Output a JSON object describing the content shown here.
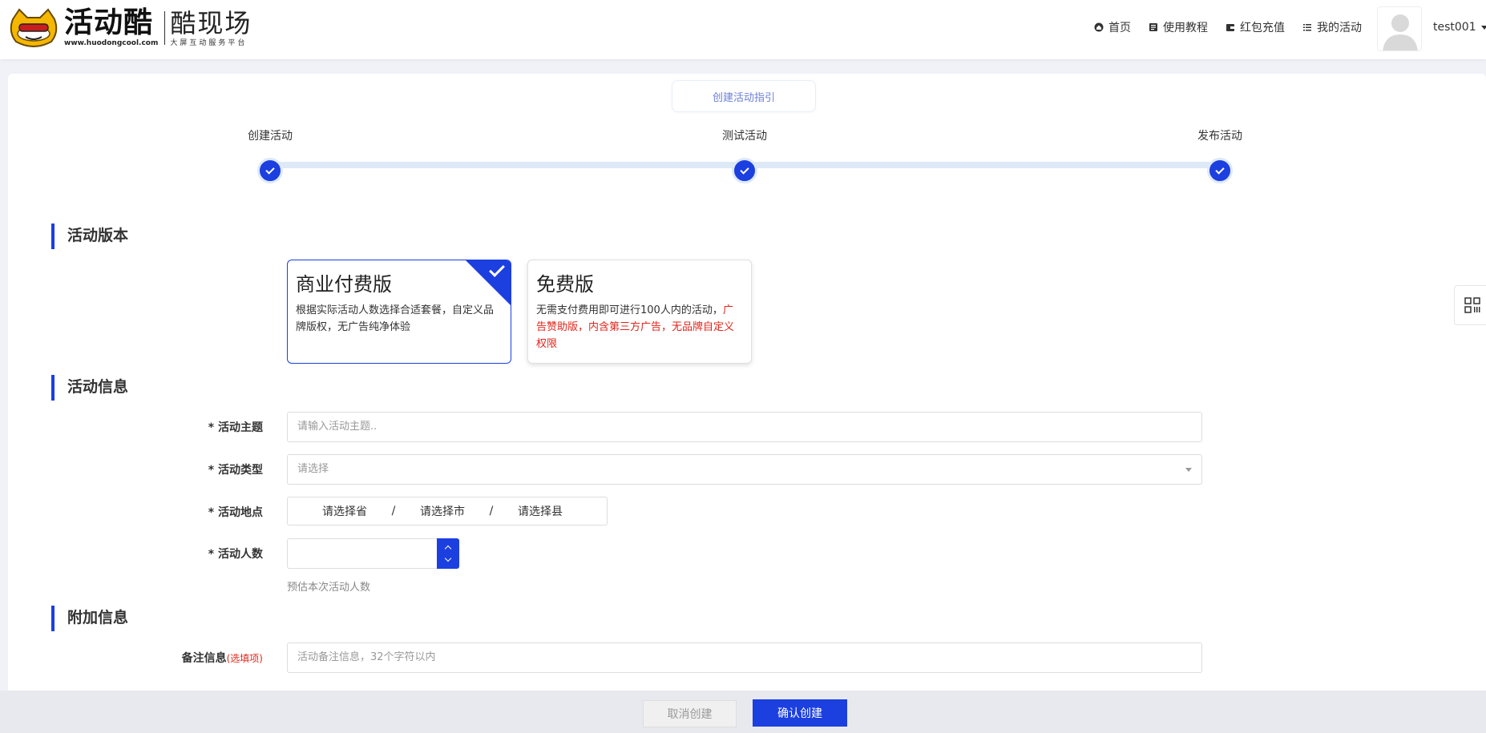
{
  "header": {
    "logo_main": "活动酷",
    "logo_url": "www.huodongcool.com",
    "logo_sub_main": "酷现场",
    "logo_sub_small": "大屏互动服务平台",
    "nav": [
      {
        "label": "首页",
        "icon": "home-icon"
      },
      {
        "label": "使用教程",
        "icon": "document-icon"
      },
      {
        "label": "红包充值",
        "icon": "wallet-icon"
      },
      {
        "label": "我的活动",
        "icon": "list-icon"
      }
    ],
    "username": "test001"
  },
  "guide_button": "创建活动指引",
  "steps": [
    {
      "label": "创建活动",
      "done": true
    },
    {
      "label": "测试活动",
      "done": true
    },
    {
      "label": "发布活动",
      "done": true
    }
  ],
  "sections": {
    "version": "活动版本",
    "info": "活动信息",
    "extra": "附加信息"
  },
  "plans": {
    "paid": {
      "title": "商业付费版",
      "desc": "根据实际活动人数选择合适套餐，自定义品牌版权，无广告纯净体验",
      "selected": true
    },
    "free": {
      "title": "免费版",
      "desc": "无需支付费用即可进行100人内的活动，",
      "desc_red": "广告赞助版，内含第三方广告，无品牌自定义权限",
      "selected": false
    }
  },
  "form": {
    "theme_label": "* 活动主题",
    "theme_placeholder": "请输入活动主题..",
    "type_label": "* 活动类型",
    "type_placeholder": "请选择",
    "location_label": "* 活动地点",
    "province": "请选择省",
    "city": "请选择市",
    "county": "请选择县",
    "separator": "/",
    "count_label": "* 活动人数",
    "count_hint": "预估本次活动人数",
    "remark_label": "备注信息",
    "remark_optional": "(选填项)",
    "remark_placeholder": "活动备注信息，32个字符以内"
  },
  "footer": {
    "cancel": "取消创建",
    "confirm": "确认创建"
  },
  "colors": {
    "accent": "#1c3fe0",
    "warning_red": "#e1251b",
    "step_track": "#dde9f7"
  }
}
